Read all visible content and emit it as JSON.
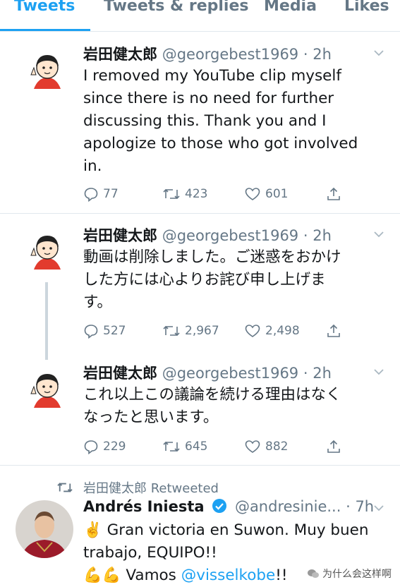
{
  "tabs": [
    "Tweets",
    "Tweets & replies",
    "Media",
    "Likes"
  ],
  "tweets": [
    {
      "name": "岩田健太郎",
      "handle": "@georgebest1969",
      "time": "· 2h",
      "text": "I removed my YouTube clip myself\nsince there is no need for further\ndiscussing this. Thank you and I\napologize to those who got involved\nin.",
      "replies": "77",
      "retweets": "423",
      "likes": "601"
    },
    {
      "name": "岩田健太郎",
      "handle": "@georgebest1969",
      "time": "· 2h",
      "text": "動画は削除しました。ご迷惑をおかけ\nした方には心よりお詫び申し上げま\nす。",
      "replies": "527",
      "retweets": "2,967",
      "likes": "2,498"
    },
    {
      "name": "岩田健太郎",
      "handle": "@georgebest1969",
      "time": "· 2h",
      "text": "これ以上この議論を続ける理由はなく\nなったと思います。",
      "replies": "229",
      "retweets": "645",
      "likes": "882"
    }
  ],
  "retweet": {
    "retweeted_by": "岩田健太郎 Retweeted",
    "name": "Andrés Iniesta",
    "handle": "@andresinie...",
    "time": "· 7h",
    "line1": "✌️ Gran victoria en Suwon. Muy buen",
    "line2": "trabajo, EQUIPO!!",
    "line3_prefix": "💪💪 Vamos",
    "mention": "@visselkobe",
    "line3_suffix": "!!"
  },
  "watermark": "为什么会这样啊",
  "colors": {
    "accent": "#1da1f2",
    "muted": "#657786",
    "divider": "#e1e8ed",
    "avatar_bg": "#e23b2e"
  }
}
